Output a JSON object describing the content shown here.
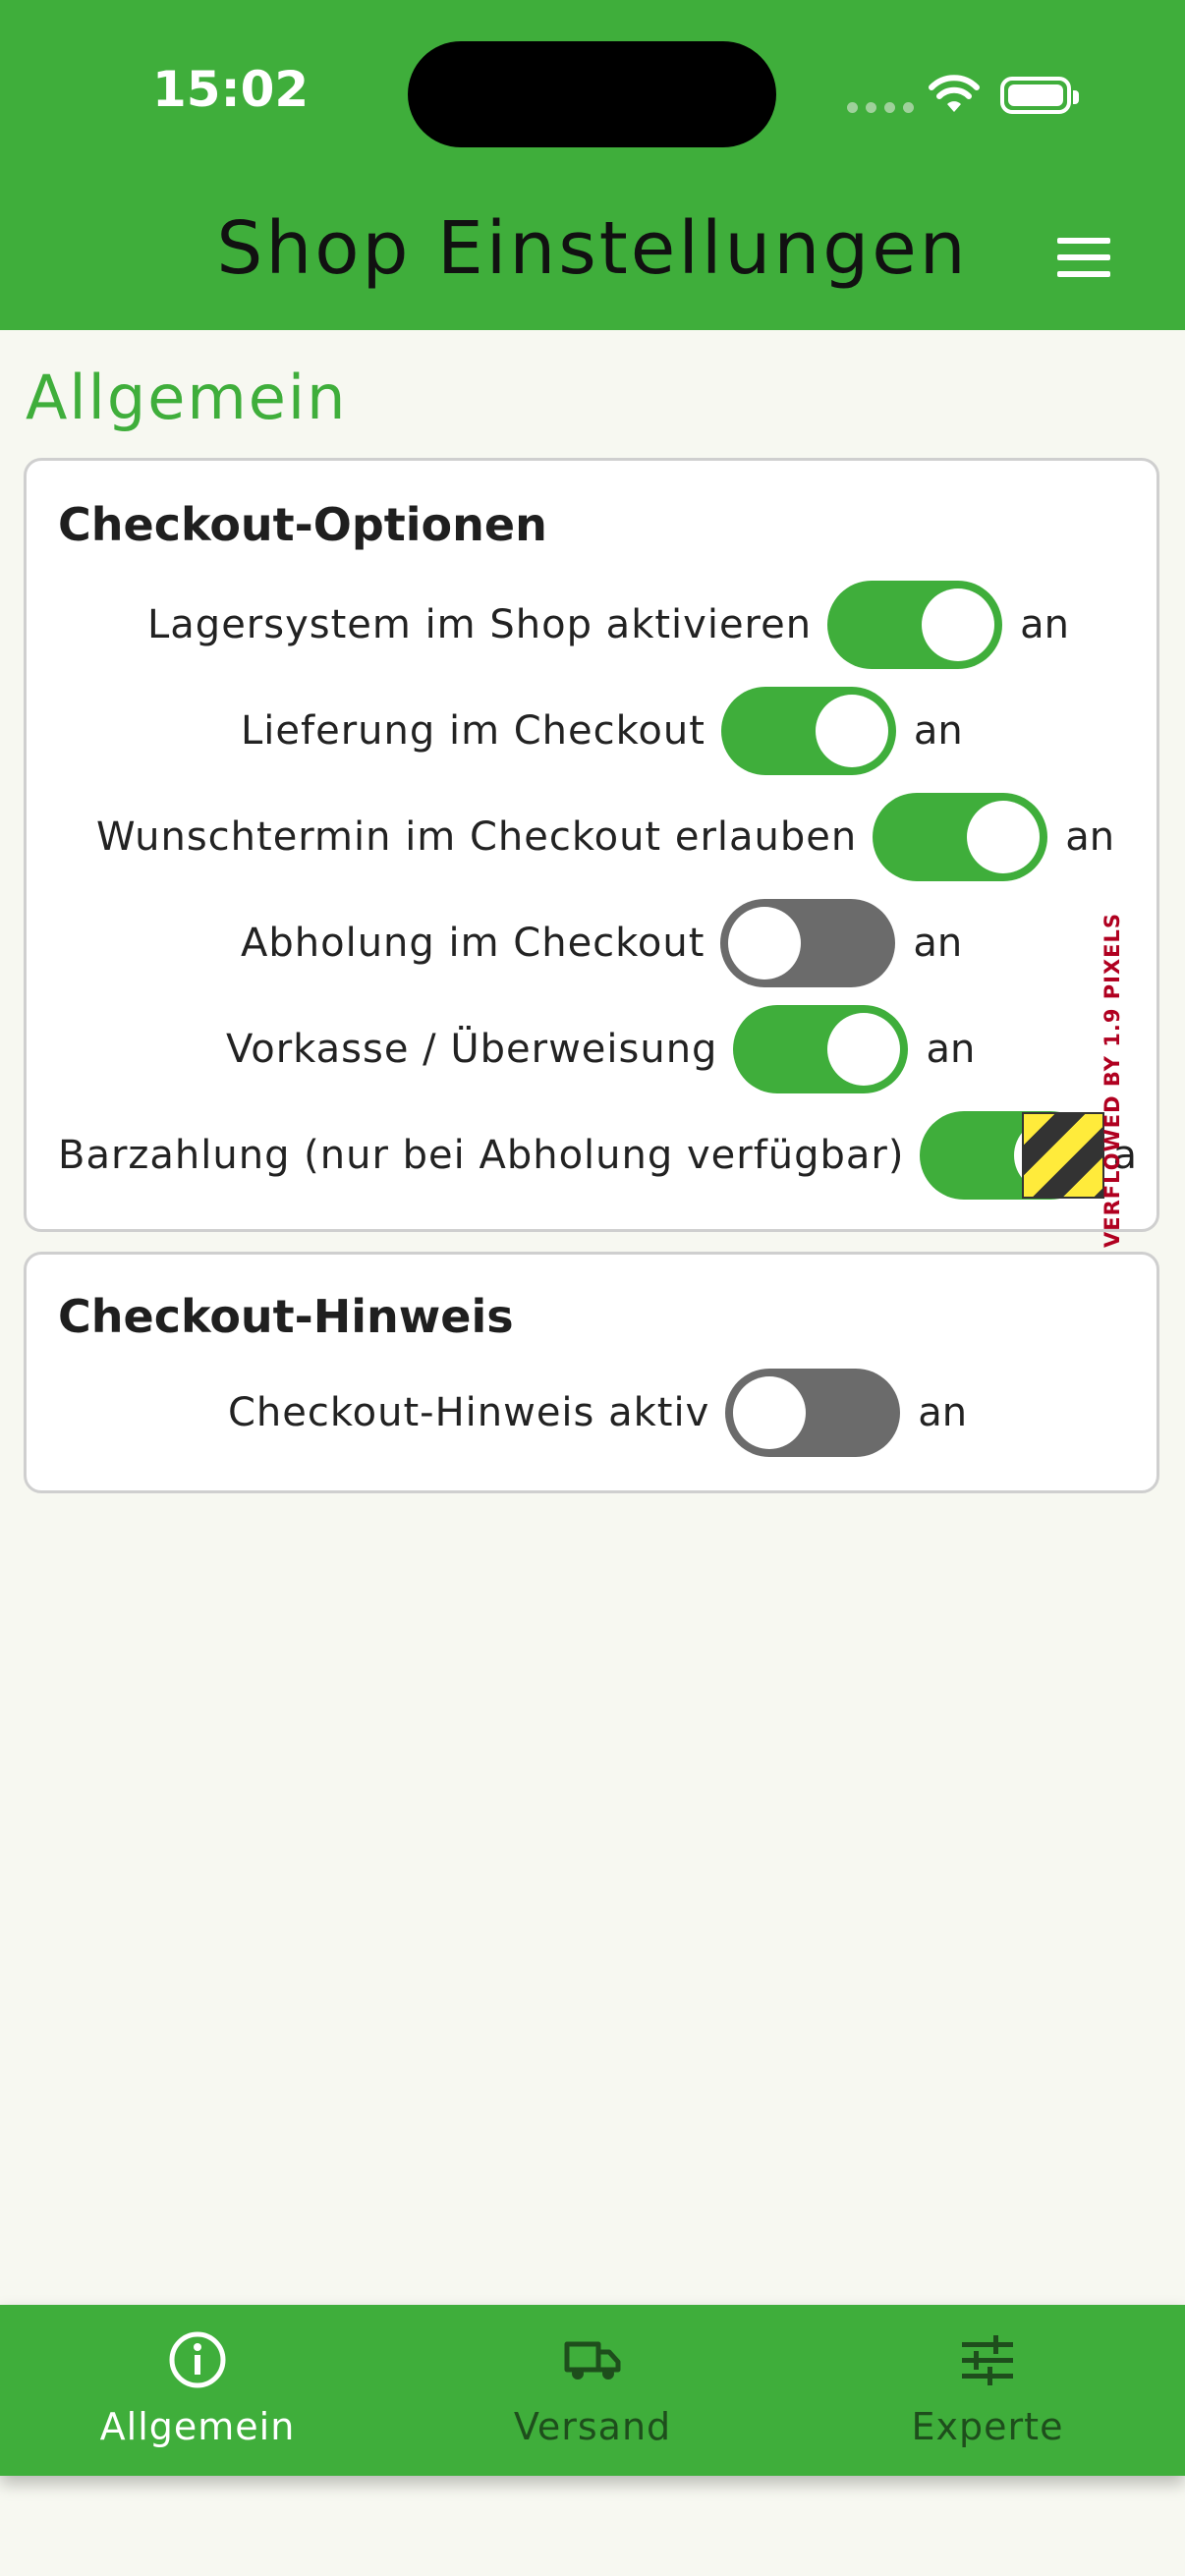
{
  "status_bar": {
    "time": "15:02"
  },
  "appbar": {
    "title": "Shop Einstellungen",
    "menu_icon": "hamburger-menu-icon"
  },
  "section": {
    "title": "Allgemein"
  },
  "checkout_options": {
    "title": "Checkout-Optionen",
    "rows": [
      {
        "label": "Lagersystem im Shop aktivieren",
        "state": "an",
        "on": true
      },
      {
        "label": "Lieferung im Checkout",
        "state": "an",
        "on": true
      },
      {
        "label": "Wunschtermin im Checkout erlauben",
        "state": "an",
        "on": true
      },
      {
        "label": "Abholung im Checkout",
        "state": "an",
        "on": false
      },
      {
        "label": "Vorkasse / Überweisung",
        "state": "an",
        "on": true
      },
      {
        "label": "Barzahlung (nur bei Abholung verfügbar)",
        "state": "a",
        "on": true
      }
    ],
    "overflow_warning": "VERFLOWED BY 1.9 PIXELS"
  },
  "checkout_hint": {
    "title": "Checkout-Hinweis",
    "rows": [
      {
        "label": "Checkout-Hinweis aktiv",
        "state": "an",
        "on": false
      }
    ]
  },
  "bottom_nav": {
    "items": [
      {
        "label": "Allgemein",
        "icon": "info-icon",
        "active": true
      },
      {
        "label": "Versand",
        "icon": "truck-icon",
        "active": false
      },
      {
        "label": "Experte",
        "icon": "sliders-icon",
        "active": false
      }
    ]
  },
  "colors": {
    "primary": "#3fae3b",
    "background": "#f7f8f1",
    "toggle_off": "#6b6b6b"
  }
}
